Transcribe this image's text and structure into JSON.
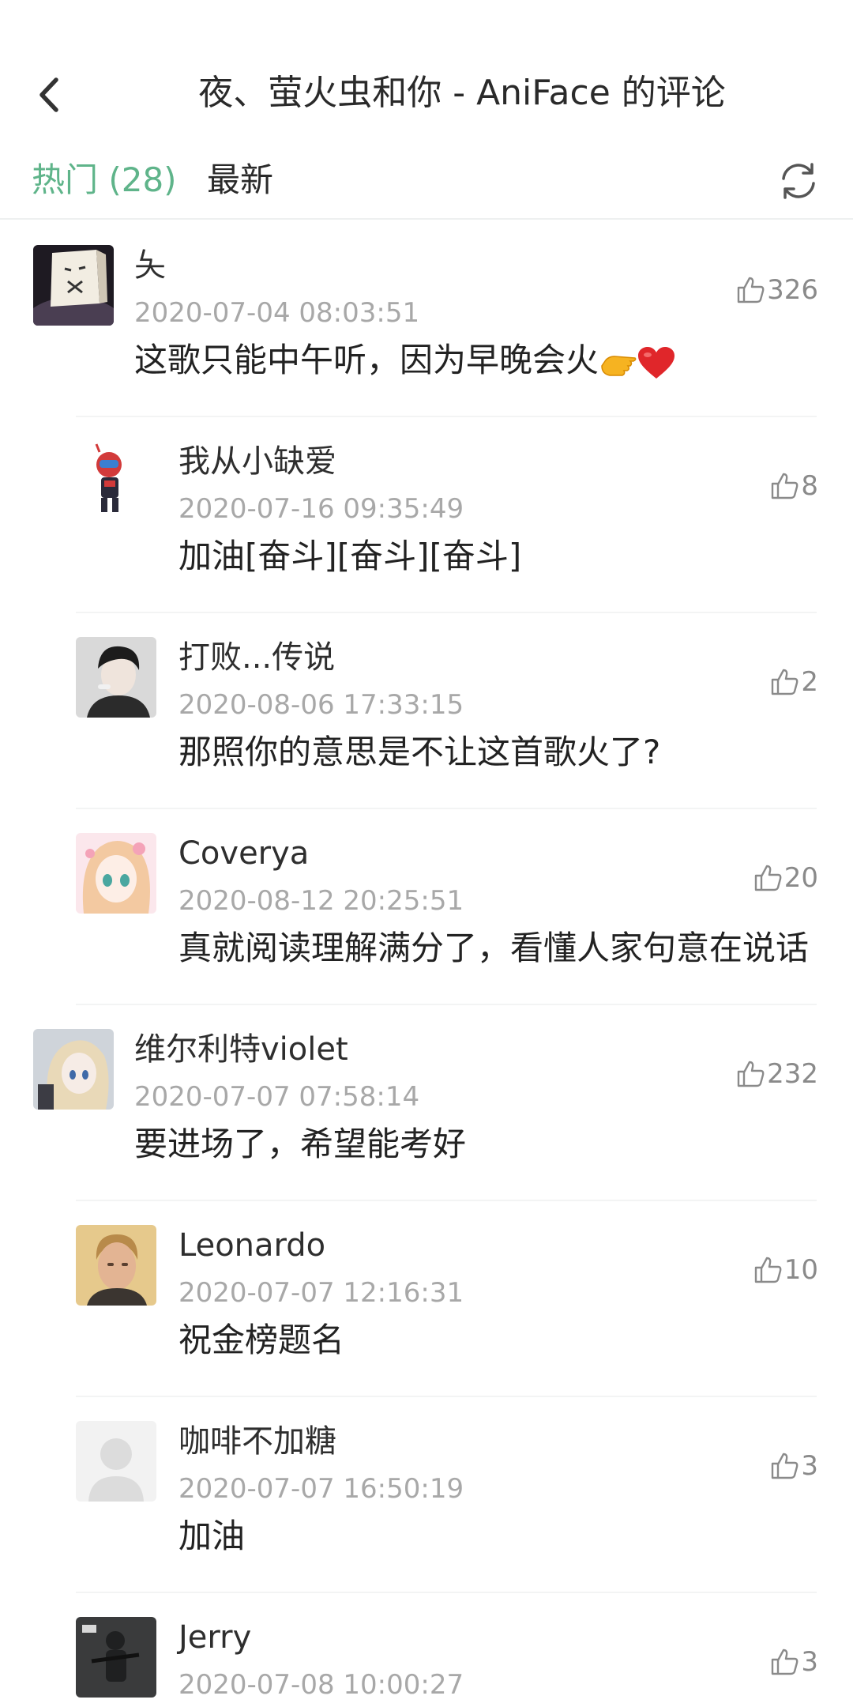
{
  "header": {
    "title": "夜、萤火虫和你 - AniFace 的评论"
  },
  "tabs": {
    "hot_label": "热门 (28)",
    "new_label": "最新"
  },
  "colors": {
    "accent": "#5fb48a",
    "text": "#222222",
    "muted": "#a8a8a8"
  },
  "comments": [
    {
      "name": "夨",
      "time": "2020-07-04 08:03:51",
      "text": "这歌只能中午听，因为早晚会火",
      "emojis": [
        "backhand-index-pointing-left",
        "red-heart"
      ],
      "likes": "326",
      "avatar_icon": "box-head-avatar",
      "level": 0
    },
    {
      "name": "我从小缺爱",
      "time": "2020-07-16 09:35:49",
      "text": "加油[奋斗][奋斗][奋斗]",
      "likes": "8",
      "avatar_icon": "kamen-rider-avatar",
      "level": 1
    },
    {
      "name": "打败...传说",
      "time": "2020-08-06 17:33:15",
      "text": "那照你的意思是不让这首歌火了?",
      "likes": "2",
      "avatar_icon": "boy-portrait-avatar",
      "level": 1
    },
    {
      "name": "Coverya",
      "time": "2020-08-12 20:25:51",
      "text": "真就阅读理解满分了，看懂人家句意在说话",
      "likes": "20",
      "avatar_icon": "anime-girl-avatar",
      "level": 1
    },
    {
      "name": "维尔利特violet",
      "time": "2020-07-07 07:58:14",
      "text": "要进场了，希望能考好",
      "likes": "232",
      "avatar_icon": "violet-avatar",
      "level": 0
    },
    {
      "name": "Leonardo",
      "time": "2020-07-07 12:16:31",
      "text": "祝金榜题名",
      "likes": "10",
      "avatar_icon": "man-portrait-avatar",
      "level": 1
    },
    {
      "name": "咖啡不加糖",
      "time": "2020-07-07 16:50:19",
      "text": "加油",
      "likes": "3",
      "avatar_icon": "default-user-avatar",
      "level": 1
    },
    {
      "name": "Jerry",
      "time": "2020-07-08 10:00:27",
      "text": "",
      "likes": "3",
      "avatar_icon": "scp-soldier-avatar",
      "level": 1
    }
  ]
}
